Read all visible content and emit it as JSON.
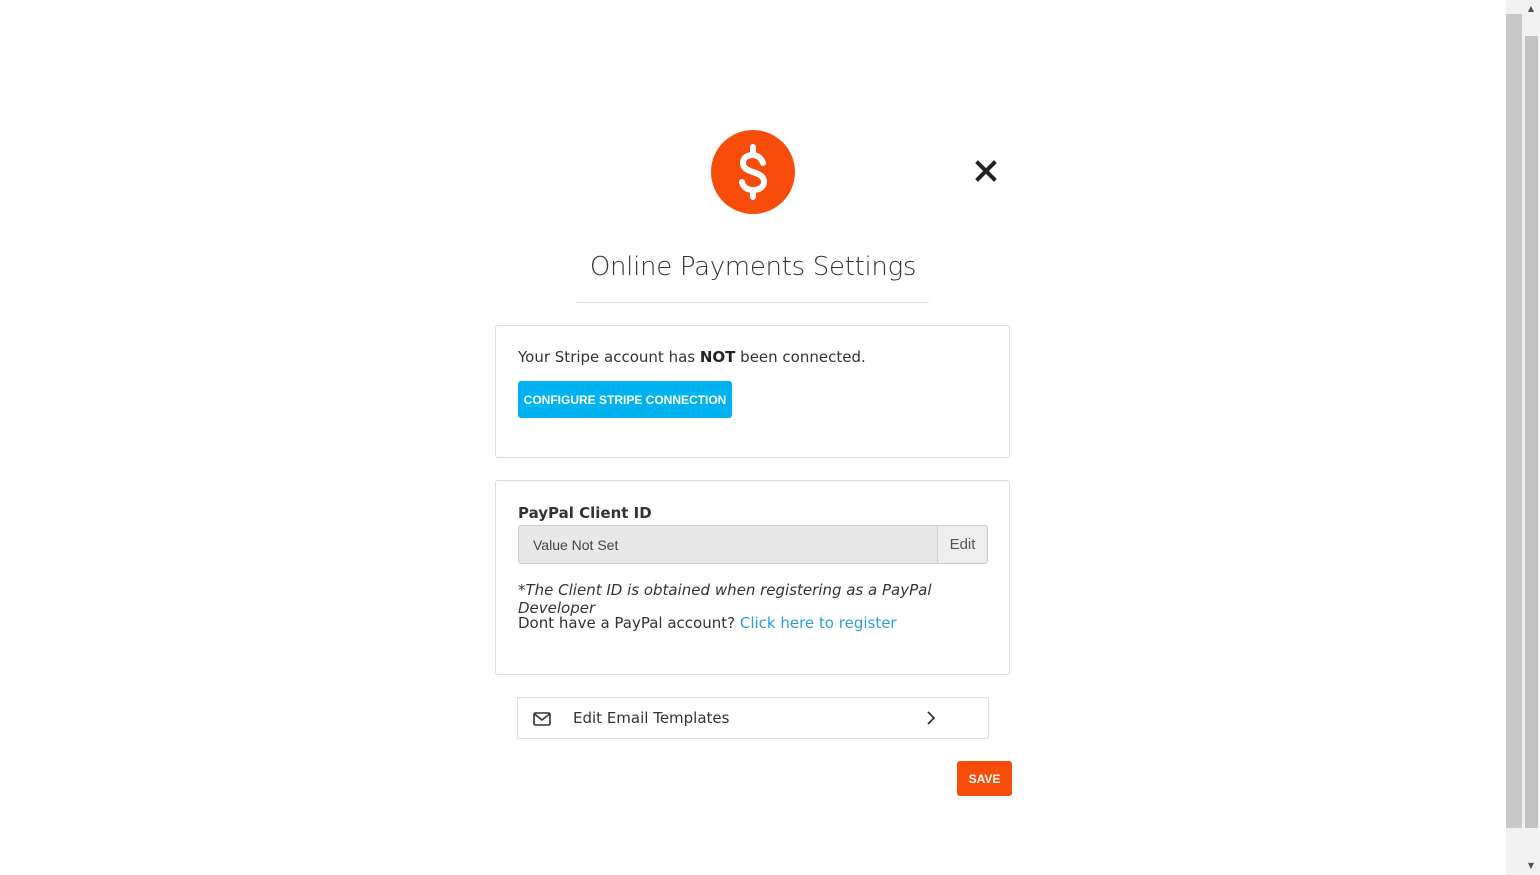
{
  "header": {
    "title": "Online Payments Settings",
    "icon": "dollar-icon",
    "close_icon": "close-icon"
  },
  "stripe": {
    "status_prefix": "Your Stripe account has ",
    "status_emphasis": "NOT",
    "status_suffix": " been connected.",
    "configure_button_label": "CONFIGURE STRIPE CONNECTION"
  },
  "paypal": {
    "label": "PayPal Client ID",
    "client_id_value": "Value Not Set",
    "edit_label": "Edit",
    "note": "*The Client ID is obtained when registering as a PayPal Developer",
    "register_prompt": "Dont have a PayPal account? ",
    "register_link": "Click here to register"
  },
  "email_templates": {
    "label": "Edit Email Templates",
    "icon": "envelope-icon",
    "chevron": "chevron-right-icon"
  },
  "actions": {
    "save_label": "SAVE"
  },
  "colors": {
    "accent": "#f84d0a",
    "stripe_button": "#00b3f0",
    "link": "#2a9fd6"
  }
}
